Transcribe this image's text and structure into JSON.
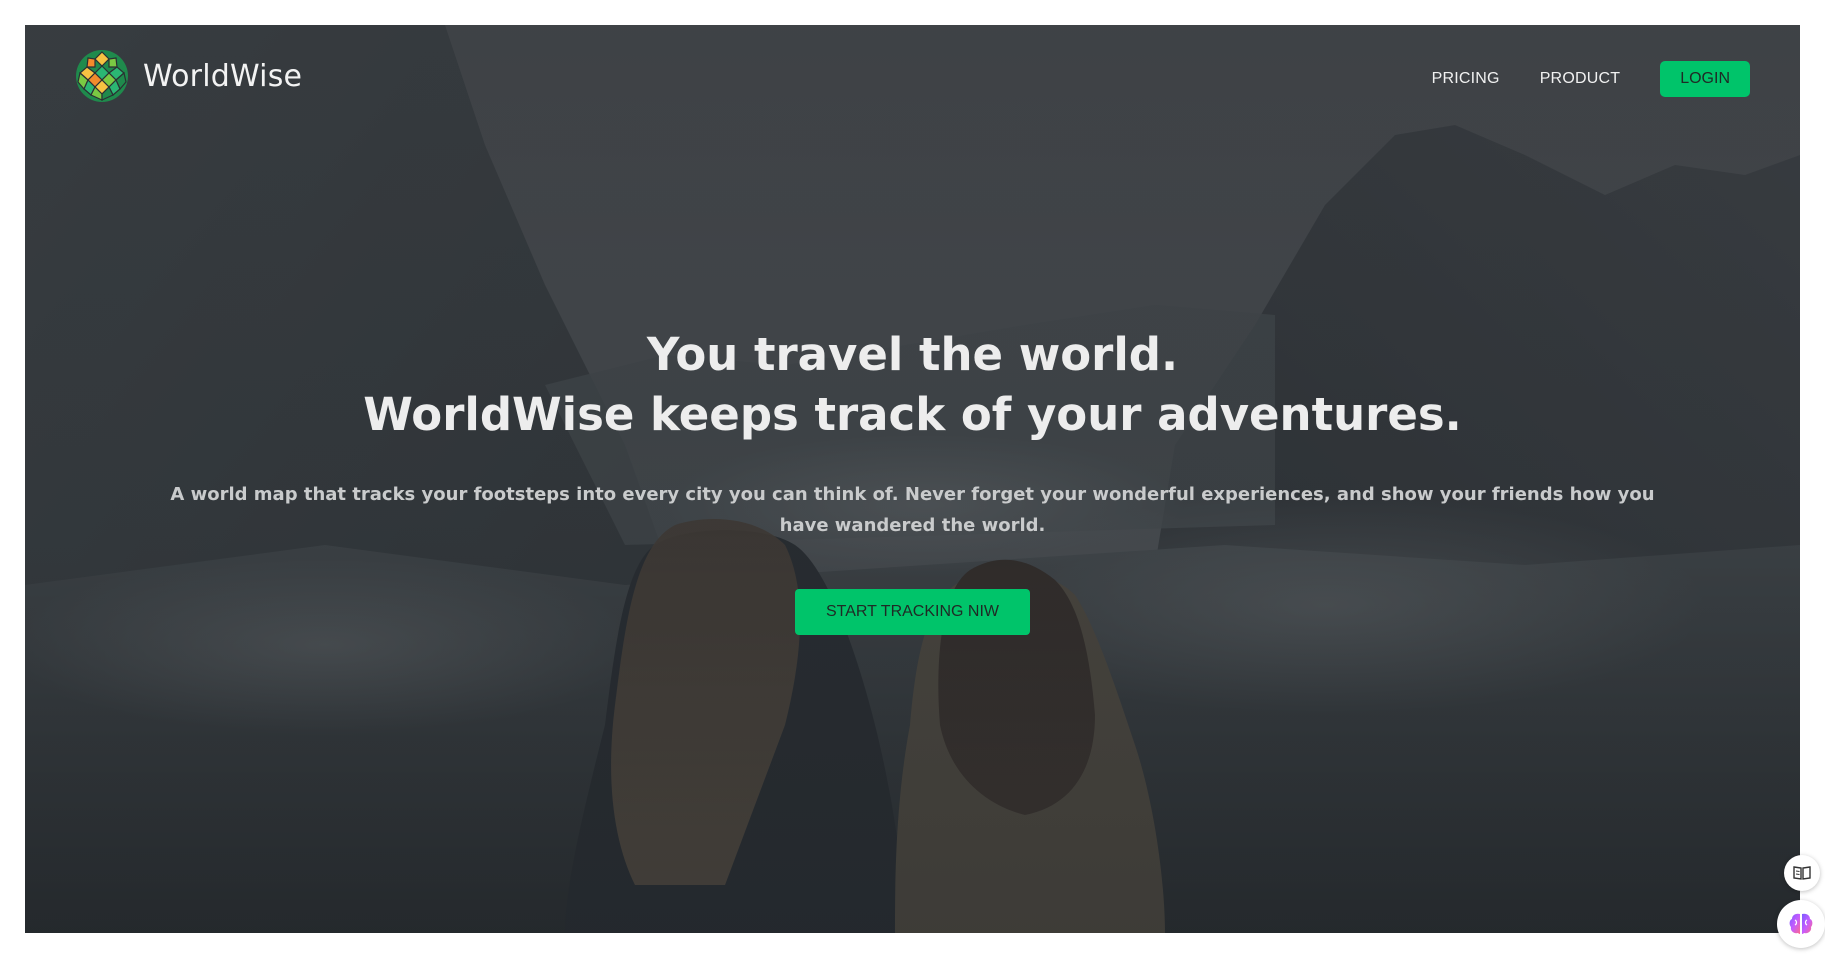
{
  "app": {
    "brand_name": "WorldWise",
    "accent_color": "#00c46a",
    "logo_icon": "globe-mosaic-icon"
  },
  "nav": {
    "links": [
      {
        "label": "PRICING"
      },
      {
        "label": "PRODUCT"
      }
    ],
    "login_label": "LOGIN"
  },
  "hero": {
    "headline_line1": "You travel the world.",
    "headline_line2": "WorldWise keeps track of your adventures.",
    "subtext": "A world map that tracks your footsteps into every city you can think of. Never forget your wonderful experiences, and show your friends how you have wandered the world.",
    "cta_label": "START TRACKING NIW"
  },
  "widgets": [
    {
      "icon": "book-reader-icon"
    },
    {
      "icon": "brain-icon"
    }
  ]
}
